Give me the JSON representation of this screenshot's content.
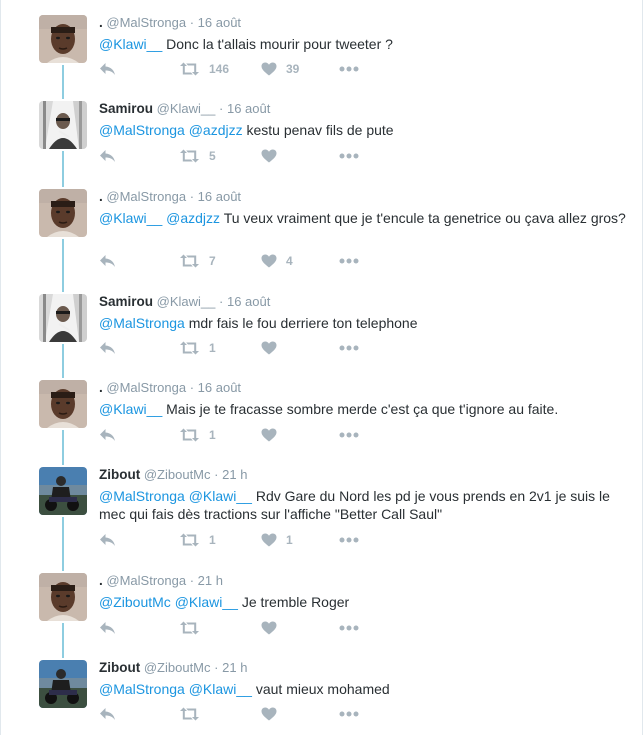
{
  "tweets": [
    {
      "avatar": "avatar-malstronga",
      "name": ".",
      "handle": "@MalStronga",
      "time": "16 août",
      "mentions": [
        "@Klawi__"
      ],
      "text": "Donc la t'allais mourir pour tweeter ?",
      "retweets": "146",
      "likes": "39"
    },
    {
      "avatar": "avatar-samirou",
      "name": "Samirou",
      "handle": "@Klawi__",
      "time": "16 août",
      "mentions": [
        "@MalStronga",
        "@azdjzz"
      ],
      "text": "kestu penav fils de pute",
      "retweets": "5",
      "likes": ""
    },
    {
      "avatar": "avatar-malstronga",
      "name": ".",
      "handle": "@MalStronga",
      "time": "16 août",
      "mentions": [
        "@Klawi__",
        "@azdjzz"
      ],
      "text": "Tu veux vraiment que je t'encule ta genetrice ou çava allez gros?",
      "retweets": "7",
      "likes": "4"
    },
    {
      "avatar": "avatar-samirou",
      "name": "Samirou",
      "handle": "@Klawi__",
      "time": "16 août",
      "mentions": [
        "@MalStronga"
      ],
      "text": "mdr fais le fou derriere ton telephone",
      "retweets": "1",
      "likes": ""
    },
    {
      "avatar": "avatar-malstronga",
      "name": ".",
      "handle": "@MalStronga",
      "time": "16 août",
      "mentions": [
        "@Klawi__"
      ],
      "text": "Mais je te fracasse sombre merde c'est ça que t'ignore au faite.",
      "retweets": "1",
      "likes": ""
    },
    {
      "avatar": "avatar-zibout",
      "name": "Zibout",
      "handle": "@ZiboutMc",
      "time": "21 h",
      "mentions": [
        "@MalStronga",
        "@Klawi__"
      ],
      "text": " Rdv Gare du Nord les pd je vous prends en 2v1 je suis le mec qui fais dès tractions sur l'affiche \"Better Call Saul\"",
      "retweets": "1",
      "likes": "1"
    },
    {
      "avatar": "avatar-malstronga",
      "name": ".",
      "handle": "@MalStronga",
      "time": "21 h",
      "mentions": [
        "@ZiboutMc",
        "@Klawi__"
      ],
      "text": "Je tremble Roger",
      "retweets": "",
      "likes": ""
    },
    {
      "avatar": "avatar-zibout",
      "name": "Zibout",
      "handle": "@ZiboutMc",
      "time": "21 h",
      "mentions": [
        "@MalStronga",
        "@Klawi__"
      ],
      "text": "vaut mieux mohamed",
      "retweets": "",
      "likes": ""
    }
  ],
  "icons": {
    "reply": "reply-icon",
    "retweet": "retweet-icon",
    "like": "heart-icon",
    "more": "more-icon"
  },
  "colors": {
    "mention": "#1b95e0",
    "thread_line": "#8ecde0",
    "muted": "#8899a6",
    "action": "#a8b4bd"
  }
}
